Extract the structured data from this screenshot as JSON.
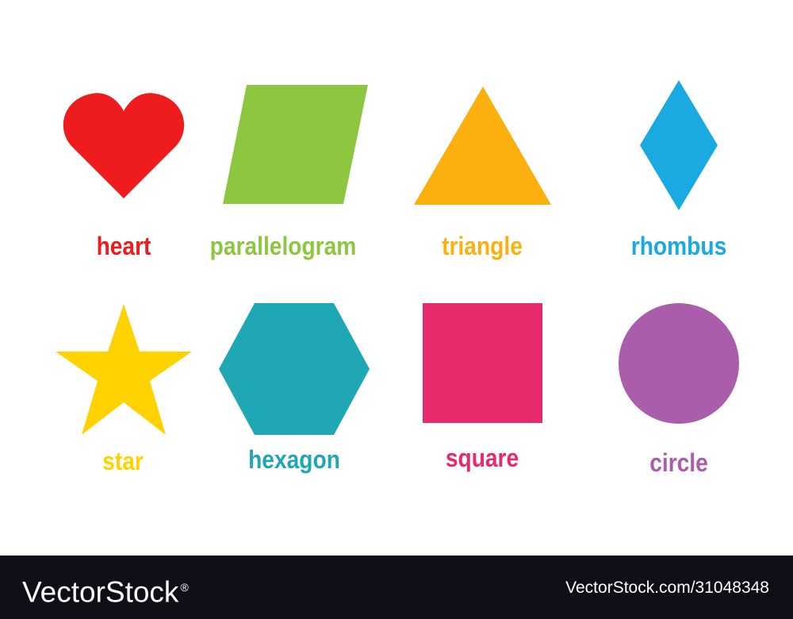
{
  "shapes": [
    {
      "name": "heart",
      "label": "heart",
      "color": "#ee1c1c",
      "icon": "heart-icon"
    },
    {
      "name": "parallelogram",
      "label": "parallelogram",
      "color": "#8dc63f",
      "icon": "parallelogram-icon"
    },
    {
      "name": "triangle",
      "label": "triangle",
      "color": "#fbb00f",
      "icon": "triangle-icon"
    },
    {
      "name": "rhombus",
      "label": "rhombus",
      "color": "#1ba9e1",
      "icon": "rhombus-icon"
    },
    {
      "name": "star",
      "label": "star",
      "color": "#ffd200",
      "icon": "star-icon"
    },
    {
      "name": "hexagon",
      "label": "hexagon",
      "color": "#1fa7b4",
      "icon": "hexagon-icon"
    },
    {
      "name": "square",
      "label": "square",
      "color": "#e72a6c",
      "icon": "square-icon"
    },
    {
      "name": "circle",
      "label": "circle",
      "color": "#aa5daa",
      "icon": "circle-icon"
    }
  ],
  "footer": {
    "brand": "VectorStock",
    "brand_mark": "®",
    "image_id": "VectorStock.com/31048348",
    "background_color": "#0f0f17",
    "text_color": "#ffffff"
  }
}
